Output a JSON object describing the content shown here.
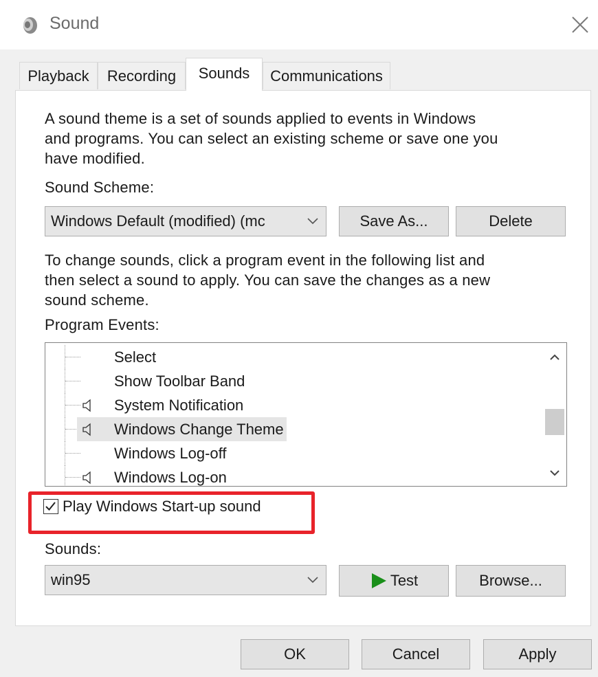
{
  "window": {
    "title": "Sound"
  },
  "tabs": [
    {
      "label": "Playback"
    },
    {
      "label": "Recording"
    },
    {
      "label": "Sounds"
    },
    {
      "label": "Communications"
    }
  ],
  "sounds_tab": {
    "intro_lines": [
      "A sound theme is a set of sounds applied to events in Windows",
      "and programs.  You can select an existing scheme or save one you",
      "have modified."
    ],
    "scheme_label": "Sound Scheme:",
    "scheme_value": "Windows Default (modified) (mc",
    "save_as_label": "Save As...",
    "delete_label": "Delete",
    "instructions_lines": [
      "To change sounds, click a program event in the following list and",
      "then select a sound to apply.  You can save the changes as a new",
      "sound scheme."
    ],
    "program_events_label": "Program Events:",
    "events": [
      {
        "label": "Select",
        "has_sound": false,
        "selected": false
      },
      {
        "label": "Show Toolbar Band",
        "has_sound": false,
        "selected": false
      },
      {
        "label": "System Notification",
        "has_sound": true,
        "selected": false
      },
      {
        "label": "Windows Change Theme",
        "has_sound": true,
        "selected": true
      },
      {
        "label": "Windows Log-off",
        "has_sound": false,
        "selected": false
      },
      {
        "label": "Windows Log-on",
        "has_sound": true,
        "selected": false
      }
    ],
    "startup_checkbox": {
      "label": "Play Windows Start-up sound",
      "checked": true
    },
    "sounds_label": "Sounds:",
    "sound_value": "win95",
    "test_label": "Test",
    "browse_label": "Browse..."
  },
  "footer": {
    "ok_label": "OK",
    "cancel_label": "Cancel",
    "apply_label": "Apply"
  },
  "colors": {
    "highlight": "#e8232a",
    "play": "#1a8f1a",
    "selected_row": "#e5e5e5"
  }
}
